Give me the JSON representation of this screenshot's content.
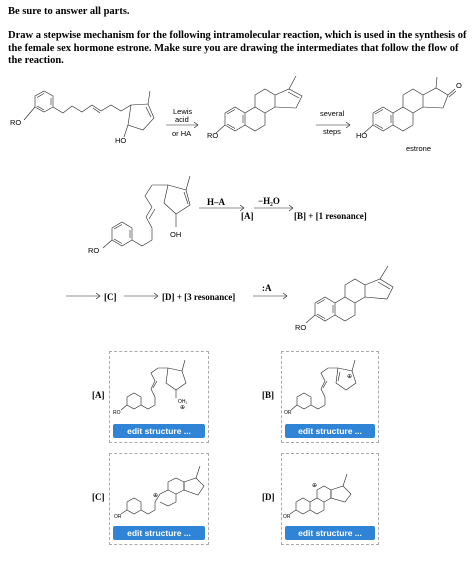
{
  "header": {
    "instruction": "Be sure to answer all parts.",
    "question": "Draw a stepwise mechanism for the following intramolecular reaction, which is used in the synthesis of the female sex hormone estrone. Make sure you are drawing the intermediates that follow the flow of the reaction."
  },
  "overall": {
    "ro1": "RO",
    "ho1": "HO",
    "reagent_line1": "Lewis",
    "reagent_line2": "acid",
    "reagent_line3": "or HA",
    "ro2": "RO",
    "steps_line1": "several",
    "steps_line2": "steps",
    "ho2": "HO",
    "o_label": "O",
    "estrone": "estrone"
  },
  "mechanism": {
    "ha": "H–A",
    "a_bracket": "[A]",
    "minus_water": "−H₂O",
    "b_text": "[B] + [1 resonance]",
    "oh": "OH",
    "ro": "RO",
    "c_text": "[C]",
    "d_text": "[D] + [3 resonance]",
    "base": ":A",
    "ro_final": "RO"
  },
  "answers": {
    "a_label": "[A]",
    "b_label": "[B]",
    "c_label": "[C]",
    "d_label": "[D]",
    "a_ro": "RO",
    "b_or": "OR",
    "c_or": "OR",
    "d_or": "OR",
    "a_oh2": "OH₂",
    "plus": "⊕",
    "edit_button": "edit structure ..."
  }
}
